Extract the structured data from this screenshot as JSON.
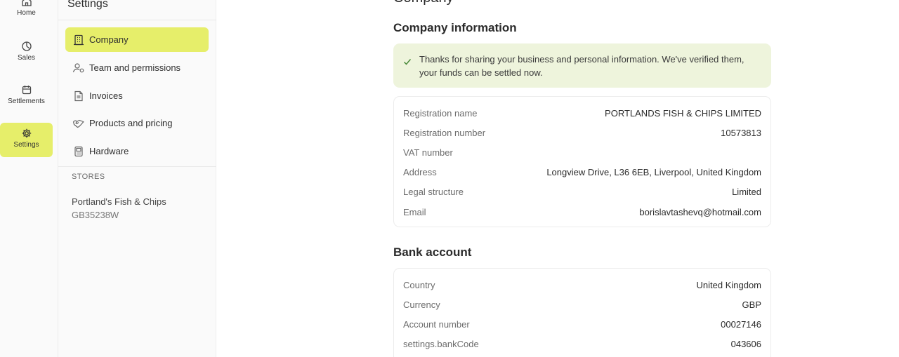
{
  "rail": {
    "items": [
      {
        "label": "Home",
        "icon": "home-icon"
      },
      {
        "label": "Sales",
        "icon": "clock-icon"
      },
      {
        "label": "Settlements",
        "icon": "calendar-icon"
      },
      {
        "label": "Settings",
        "icon": "gear-icon",
        "active": true
      }
    ]
  },
  "subnav": {
    "title": "Settings",
    "items": [
      {
        "label": "Company",
        "icon": "building-icon",
        "active": true
      },
      {
        "label": "Team and permissions",
        "icon": "users-icon"
      },
      {
        "label": "Invoices",
        "icon": "document-icon"
      },
      {
        "label": "Products and pricing",
        "icon": "handshake-icon"
      },
      {
        "label": "Hardware",
        "icon": "device-icon"
      }
    ],
    "stores_heading": "STORES",
    "store": {
      "name": "Portland's Fish & Chips",
      "id": "GB35238W"
    }
  },
  "main": {
    "cut_heading": "Company",
    "company_section": {
      "title": "Company information",
      "banner": "Thanks for sharing your business and personal information. We've verified them, your funds can be settled now.",
      "rows": [
        {
          "label": "Registration name",
          "value": "PORTLANDS FISH & CHIPS LIMITED"
        },
        {
          "label": "Registration number",
          "value": "10573813"
        },
        {
          "label": "VAT number",
          "value": ""
        },
        {
          "label": "Address",
          "value": "Longview Drive, L36 6EB, Liverpool, United Kingdom"
        },
        {
          "label": "Legal structure",
          "value": "Limited"
        },
        {
          "label": "Email",
          "value": "borislavtashevq@hotmail.com"
        }
      ]
    },
    "bank_section": {
      "title": "Bank account",
      "rows": [
        {
          "label": "Country",
          "value": "United Kingdom"
        },
        {
          "label": "Currency",
          "value": "GBP"
        },
        {
          "label": "Account number",
          "value": "00027146"
        },
        {
          "label": "settings.bankCode",
          "value": "043606"
        }
      ]
    }
  },
  "colors": {
    "accent": "#e6ee6a",
    "banner_bg": "#eef4dc",
    "check": "#4a8a3a"
  }
}
